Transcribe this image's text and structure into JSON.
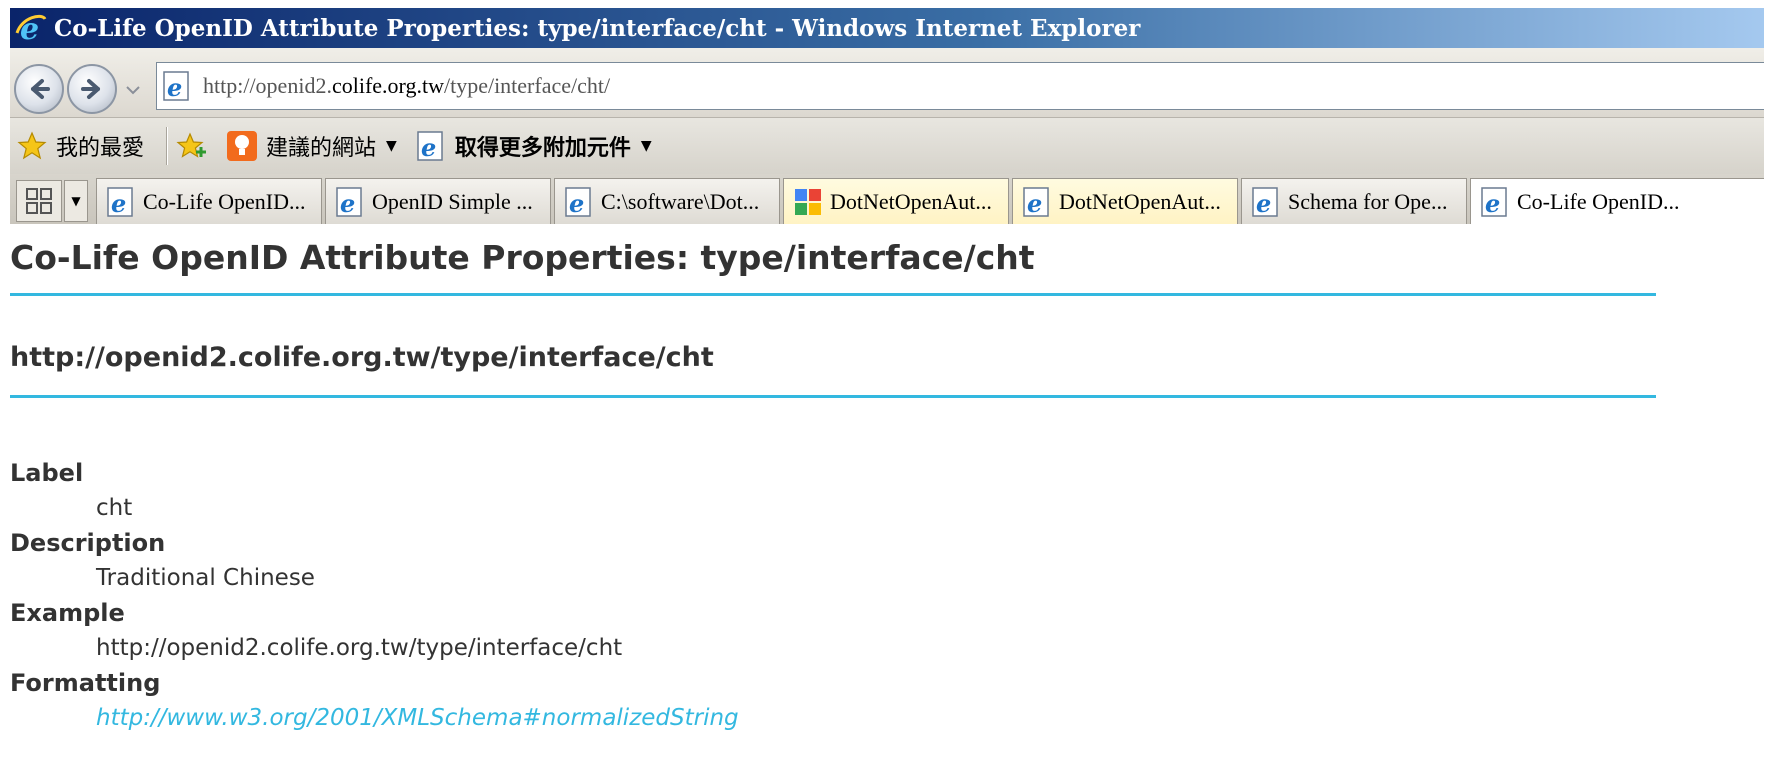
{
  "window": {
    "title": "Co-Life OpenID Attribute Properties: type/interface/cht - Windows Internet Explorer"
  },
  "address_bar": {
    "url_prefix": "http://openid2.",
    "url_host": "colife.org.tw",
    "url_path": "/type/interface/cht/"
  },
  "favorites_bar": {
    "favorites_label": "我的最愛",
    "suggested_sites_label": "建議的網站",
    "get_addons_label": "取得更多附加元件"
  },
  "tabs": [
    {
      "label": "Co-Life OpenID...",
      "icon": "ie-page-icon",
      "state": "normal"
    },
    {
      "label": "OpenID Simple ...",
      "icon": "ie-page-icon",
      "state": "normal"
    },
    {
      "label": "C:\\software\\Dot...",
      "icon": "ie-page-icon",
      "state": "normal"
    },
    {
      "label": "DotNetOpenAut...",
      "icon": "google-icon",
      "state": "highlight"
    },
    {
      "label": "DotNetOpenAut...",
      "icon": "ie-page-icon",
      "state": "highlight"
    },
    {
      "label": "Schema for Ope...",
      "icon": "ie-page-icon",
      "state": "normal"
    },
    {
      "label": "Co-Life OpenID...",
      "icon": "ie-page-icon",
      "state": "active"
    }
  ],
  "page": {
    "heading": "Co-Life OpenID Attribute Properties: type/interface/cht",
    "subheading": "http://openid2.colife.org.tw/type/interface/cht",
    "properties": [
      {
        "term": "Label",
        "value": "cht"
      },
      {
        "term": "Description",
        "value": "Traditional Chinese"
      },
      {
        "term": "Example",
        "value": "http://openid2.colife.org.tw/type/interface/cht"
      },
      {
        "term": "Formatting",
        "value": "http://www.w3.org/2001/XMLSchema#normalizedString",
        "is_link": true
      }
    ]
  },
  "colors": {
    "accent_rule": "#33b8e0",
    "link": "#33b8e0",
    "heading_text": "#333333",
    "titlebar_start": "#0a246a"
  }
}
